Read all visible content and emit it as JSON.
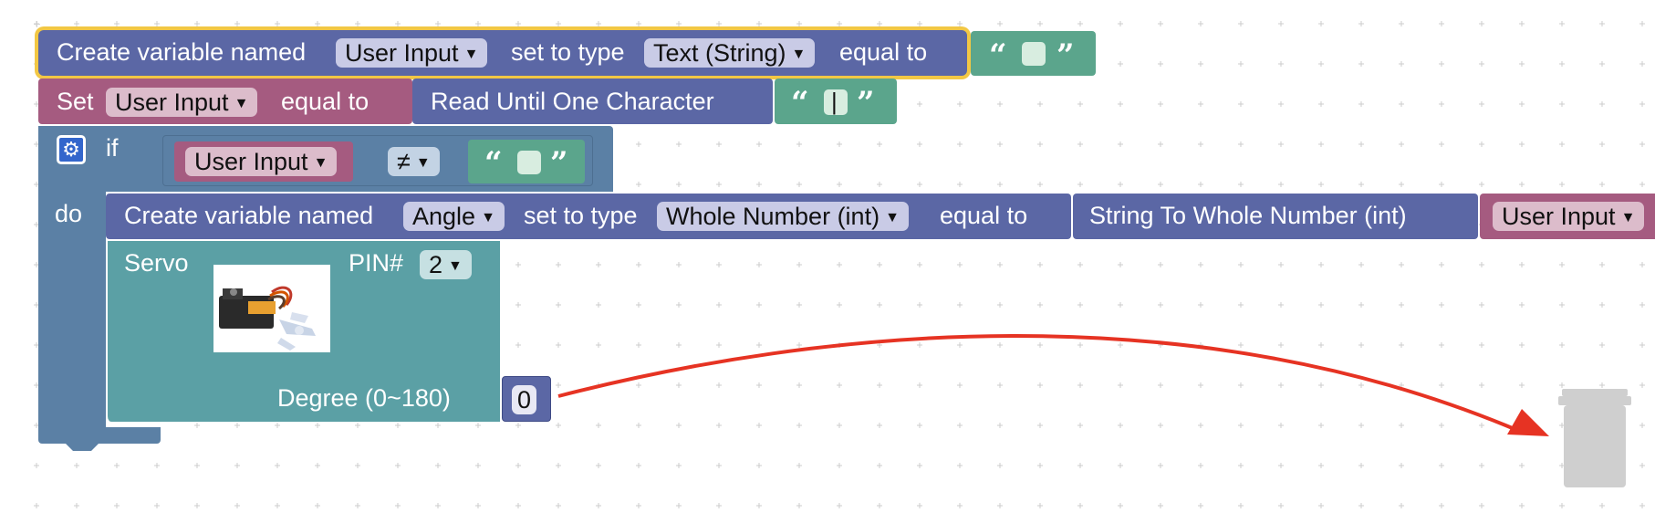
{
  "block1": {
    "label_create": "Create variable named",
    "var_name": "User Input",
    "label_type": "set to type",
    "type_value": "Text (String)",
    "label_equal": "equal to",
    "open_quote": "“",
    "close_quote": "”"
  },
  "block2": {
    "label_set": "Set",
    "var_name": "User Input",
    "label_equal": "equal to",
    "read_label": "Read Until One Character",
    "char_value": "|",
    "open_quote": "“",
    "close_quote": "”"
  },
  "if_block": {
    "label_if": "if",
    "label_do": "do",
    "var_name": "User Input",
    "operator": "≠",
    "open_quote": "“",
    "close_quote": "”"
  },
  "block3": {
    "label_create": "Create variable named",
    "var_name": "Angle",
    "label_type": "set to type",
    "type_value": "Whole Number (int)",
    "label_equal": "equal to",
    "convert_label": "String To Whole Number (int)",
    "arg_var": "User Input"
  },
  "servo": {
    "label": "Servo",
    "pin_label": "PIN#",
    "pin_value": "2",
    "degree_label": "Degree (0~180)",
    "degree_value": "0"
  },
  "colors": {
    "variables": "#5b67a5",
    "set": "#a55b80",
    "text": "#5ba58c",
    "control": "#5b80a5",
    "servo": "#5ba0a5",
    "selection": "#f2c744",
    "arrow": "#e63323",
    "trash": "#cfcfcf"
  },
  "icons": {
    "gear": "gear-icon",
    "trash": "trash-icon",
    "dropdown": "chevron-down-icon"
  }
}
